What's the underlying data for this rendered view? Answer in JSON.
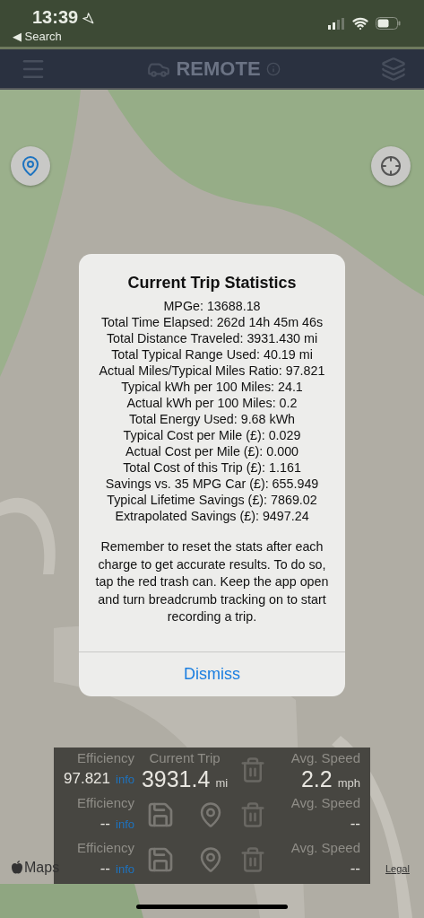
{
  "status_bar": {
    "time": "13:39",
    "back_label": "◀ Search"
  },
  "header": {
    "title": "REMOTE"
  },
  "dialog": {
    "title": "Current Trip Statistics",
    "stats": [
      "MPGe: 13688.18",
      "Total Time Elapsed: 262d 14h 45m 46s",
      "Total Distance Traveled: 3931.430 mi",
      "Total Typical Range Used: 40.19 mi",
      "Actual Miles/Typical Miles Ratio: 97.821",
      "Typical kWh per 100 Miles: 24.1",
      "Actual kWh per 100 Miles: 0.2",
      "Total Energy Used: 9.68 kWh",
      "Typical Cost per Mile (£): 0.029",
      "Actual Cost per Mile (£): 0.000",
      "Total Cost of this Trip (£): 1.161",
      "Savings vs. 35 MPG Car (£): 655.949",
      "Typical Lifetime Savings (£): 7869.02",
      "Extrapolated Savings (£): 9497.24"
    ],
    "note": "Remember to reset the stats after each charge to get accurate results. To do so, tap the red trash can. Keep the app open and turn breadcrumb tracking on to start recording a trip.",
    "button": "Dismiss"
  },
  "trip_panel": {
    "rows": [
      {
        "kind": "current",
        "efficiency_label": "Efficiency",
        "efficiency": "97.821",
        "info": "info",
        "trip_label": "Current Trip",
        "distance": "3931.4",
        "distance_unit": "mi",
        "speed_label": "Avg. Speed",
        "speed": "2.2",
        "speed_unit": "mph"
      },
      {
        "kind": "saved",
        "efficiency_label": "Efficiency",
        "efficiency": "--",
        "info": "info",
        "speed_label": "Avg. Speed",
        "speed": "--"
      },
      {
        "kind": "saved",
        "efficiency_label": "Efficiency",
        "efficiency": "--",
        "info": "info",
        "speed_label": "Avg. Speed",
        "speed": "--"
      }
    ]
  },
  "map_footer": {
    "logo": "Maps",
    "legal": "Legal"
  }
}
